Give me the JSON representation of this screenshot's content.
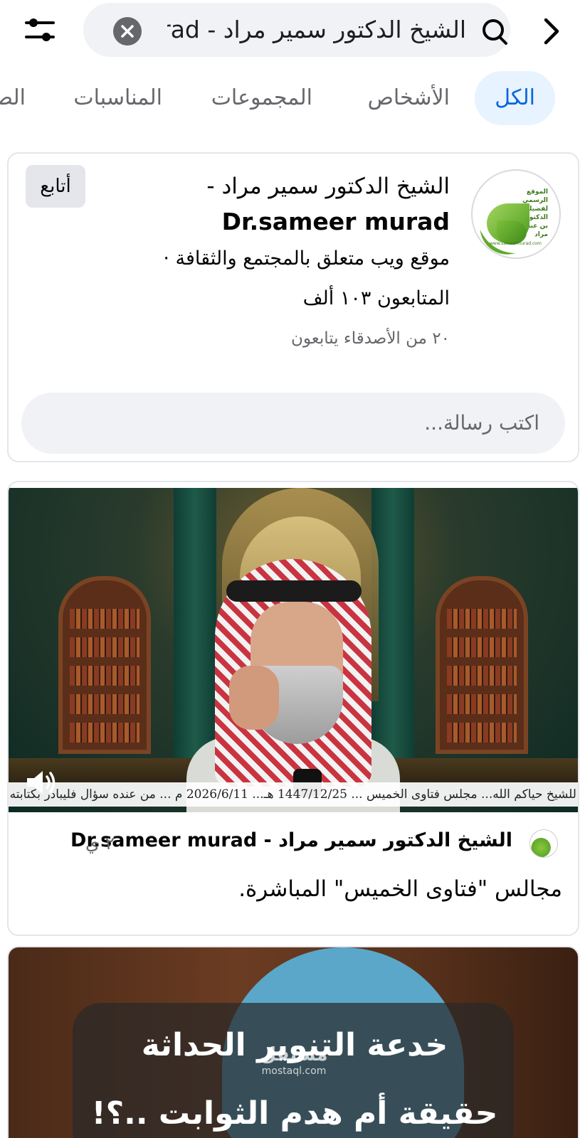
{
  "search": {
    "query": "الشيخ الدكتور سمير مراد - rad"
  },
  "icons": {
    "filter": "sliders-icon",
    "clear": "close-circle-icon",
    "search": "search-icon",
    "back": "chevron-right-icon",
    "volume": "speaker-icon"
  },
  "tabs": [
    {
      "label": "الكل",
      "active": true
    },
    {
      "label": "الأشخاص",
      "active": false
    },
    {
      "label": "المجموعات",
      "active": false
    },
    {
      "label": "المناسبات",
      "active": false
    },
    {
      "label": "الص",
      "active": false
    }
  ],
  "profile": {
    "name_ar": "الشيخ الدكتور سمير مراد -",
    "name_en": "Dr.sameer murad",
    "category": "موقع ويب متعلق بالمجتمع والثقافة ·",
    "followers": "المتابعون ١٠٣ ألف",
    "friends": "٢٠ من الأصدقاء يتابعون",
    "follow_label": "أتابع",
    "message_placeholder": "اكتب رسالة...",
    "avatar_text": "الموقع الرسمي لفضيلة الشيخ الدكتور سمير بن عبد الرزاق مراد",
    "avatar_site": "www.sameermurad.com"
  },
  "post": {
    "ticker": "للشيخ حياكم الله...  مجلس فتاوى الخميس ... 1447/12/25 هـ... 2026/6/11 م ... من عنده سؤال فليبادر بكتابته كـ",
    "author": "الشيخ الدكتور سمير مراد - Dr.sameer murad",
    "time": "٢ ي",
    "text": "مجالس \"فتاوى الخميس\" المباشرة."
  },
  "post2": {
    "title": "خدعة التنوير الحداثة",
    "subtitle": "حقيقة أم هدم الثوابت ..؟!"
  },
  "watermark": {
    "ar": "مستقل",
    "en": "mostaql.com"
  },
  "colors": {
    "accent": "#0a66d8",
    "active_tab_bg": "#e7f3ff",
    "secondary_text": "#65676b",
    "surface": "#f0f2f5"
  }
}
